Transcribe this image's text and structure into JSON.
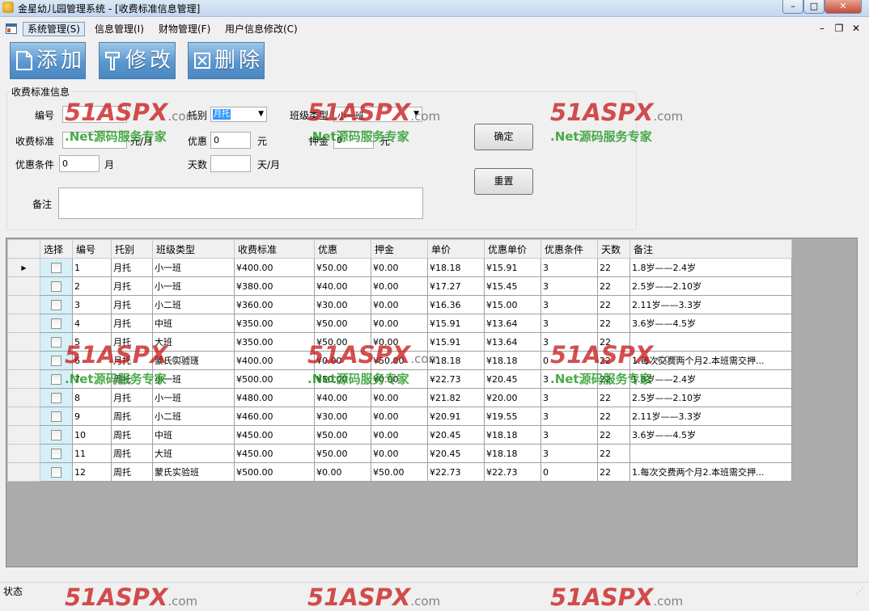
{
  "window": {
    "title": "金星幼儿园管理系统 - [收费标准信息管理]",
    "min_glyph": "–",
    "max_glyph": "□",
    "close_glyph": "✕"
  },
  "menu": {
    "items": [
      "系统管理(S)",
      "信息管理(I)",
      "财物管理(F)",
      "用户信息修改(C)"
    ],
    "mdi_min": "–",
    "mdi_restore": "❐",
    "mdi_close": "✕"
  },
  "toolbar": {
    "add": "添加",
    "edit": "修改",
    "delete": "删除"
  },
  "form": {
    "group_title": "收费标准信息",
    "id_label": "编号",
    "id_value": "",
    "type_label": "托别",
    "type_value": "月托",
    "class_label": "班级类型",
    "class_value": "小一班",
    "fee_label": "收费标准",
    "fee_value": "",
    "fee_unit": "元/月",
    "discount_label": "优惠",
    "discount_value": "0",
    "discount_unit": "元",
    "deposit_label": "押金",
    "deposit_value": "0",
    "deposit_unit": "元",
    "condition_label": "优惠条件",
    "condition_value": "0",
    "condition_unit": "月",
    "days_label": "天数",
    "days_value": "",
    "days_unit": "天/月",
    "remark_label": "备注",
    "remark_value": "",
    "confirm": "确定",
    "reset": "重置"
  },
  "grid": {
    "columns": [
      "选择",
      "编号",
      "托别",
      "班级类型",
      "收费标准",
      "优惠",
      "押金",
      "单价",
      "优惠单价",
      "优惠条件",
      "天数",
      "备注"
    ],
    "current_row_marker": "▶",
    "rows": [
      [
        "1",
        "月托",
        "小一班",
        "¥400.00",
        "¥50.00",
        "¥0.00",
        "¥18.18",
        "¥15.91",
        "3",
        "22",
        "1.8岁——2.4岁"
      ],
      [
        "2",
        "月托",
        "小一班",
        "¥380.00",
        "¥40.00",
        "¥0.00",
        "¥17.27",
        "¥15.45",
        "3",
        "22",
        "2.5岁——2.10岁"
      ],
      [
        "3",
        "月托",
        "小二班",
        "¥360.00",
        "¥30.00",
        "¥0.00",
        "¥16.36",
        "¥15.00",
        "3",
        "22",
        "2.11岁——3.3岁"
      ],
      [
        "4",
        "月托",
        "中班",
        "¥350.00",
        "¥50.00",
        "¥0.00",
        "¥15.91",
        "¥13.64",
        "3",
        "22",
        "3.6岁——4.5岁"
      ],
      [
        "5",
        "月托",
        "大班",
        "¥350.00",
        "¥50.00",
        "¥0.00",
        "¥15.91",
        "¥13.64",
        "3",
        "22",
        ""
      ],
      [
        "6",
        "月托",
        "蒙氏实验班",
        "¥400.00",
        "¥0.00",
        "¥50.00",
        "¥18.18",
        "¥18.18",
        "0",
        "22",
        "1.每次交费两个月2.本班需交押..."
      ],
      [
        "7",
        "周托",
        "小一班",
        "¥500.00",
        "¥50.00",
        "¥0.00",
        "¥22.73",
        "¥20.45",
        "3",
        "22",
        "1.8岁——2.4岁"
      ],
      [
        "8",
        "月托",
        "小一班",
        "¥480.00",
        "¥40.00",
        "¥0.00",
        "¥21.82",
        "¥20.00",
        "3",
        "22",
        "2.5岁——2.10岁"
      ],
      [
        "9",
        "周托",
        "小二班",
        "¥460.00",
        "¥30.00",
        "¥0.00",
        "¥20.91",
        "¥19.55",
        "3",
        "22",
        "2.11岁——3.3岁"
      ],
      [
        "10",
        "周托",
        "中班",
        "¥450.00",
        "¥50.00",
        "¥0.00",
        "¥20.45",
        "¥18.18",
        "3",
        "22",
        "3.6岁——4.5岁"
      ],
      [
        "11",
        "周托",
        "大班",
        "¥450.00",
        "¥50.00",
        "¥0.00",
        "¥20.45",
        "¥18.18",
        "3",
        "22",
        ""
      ],
      [
        "12",
        "周托",
        "蒙氏实验班",
        "¥500.00",
        "¥0.00",
        "¥50.00",
        "¥22.73",
        "¥22.73",
        "0",
        "22",
        "1.每次交费两个月2.本班需交押..."
      ]
    ]
  },
  "status": {
    "text": "状态",
    "grip": "⋰"
  },
  "watermark": {
    "logo": "51ASPX",
    "logo_suffix": ".com",
    "sub": ".Net源码服务专家"
  },
  "colors": {
    "toolbar_blue": "#5b97cf",
    "checkbox_column": "#d6f0f7",
    "grid_background": "#ababab"
  }
}
